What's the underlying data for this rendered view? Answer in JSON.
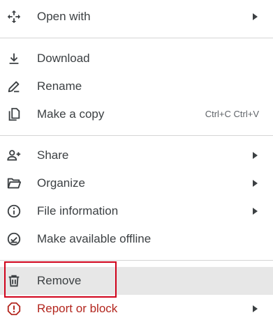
{
  "menu": {
    "items": [
      {
        "id": "open-with",
        "label": "Open with",
        "icon": "move-arrows-icon",
        "submenu": true
      },
      {
        "id": "download",
        "label": "Download",
        "icon": "download-icon"
      },
      {
        "id": "rename",
        "label": "Rename",
        "icon": "pencil-icon"
      },
      {
        "id": "make-copy",
        "label": "Make a copy",
        "icon": "copy-icon",
        "shortcut": "Ctrl+C Ctrl+V"
      },
      {
        "id": "share",
        "label": "Share",
        "icon": "person-add-icon",
        "submenu": true
      },
      {
        "id": "organize",
        "label": "Organize",
        "icon": "folder-open-icon",
        "submenu": true
      },
      {
        "id": "file-information",
        "label": "File information",
        "icon": "info-icon",
        "submenu": true
      },
      {
        "id": "make-offline",
        "label": "Make available offline",
        "icon": "offline-check-icon"
      },
      {
        "id": "remove",
        "label": "Remove",
        "icon": "trash-icon",
        "hovered": true
      },
      {
        "id": "report",
        "label": "Report or block",
        "icon": "report-icon",
        "submenu": true,
        "danger": true
      }
    ]
  },
  "colors": {
    "text": "#3c4043",
    "danger": "#b3261e",
    "hover_bg": "#e7e7e7",
    "divider": "#d5d5d5",
    "highlight_border": "#d0021b"
  }
}
